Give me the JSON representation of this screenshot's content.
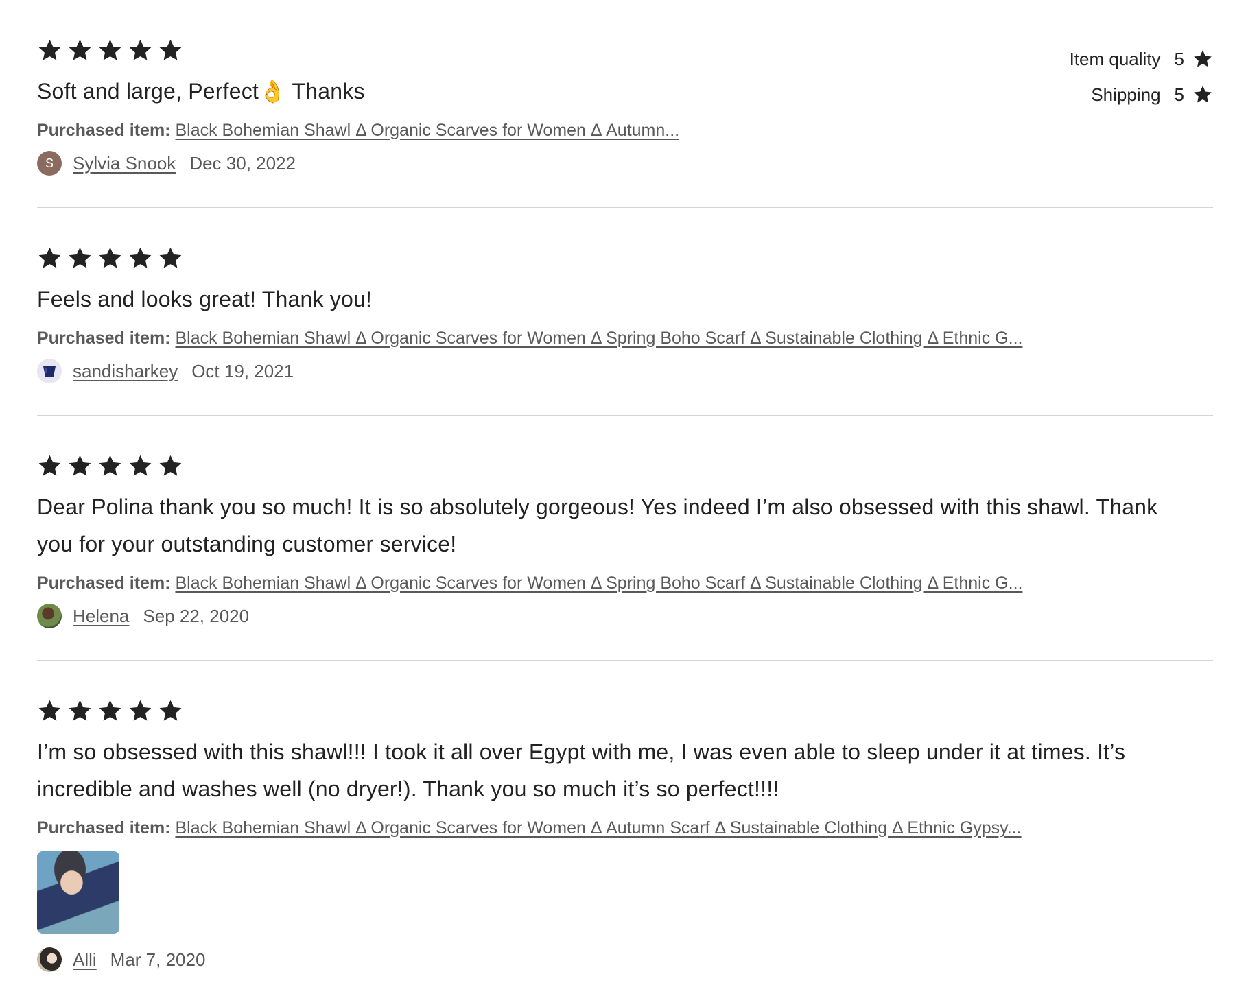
{
  "reviews": [
    {
      "rating": 5,
      "text": "Soft and large, Perfect👌 Thanks",
      "purchased_label": "Purchased item:",
      "purchased_item": "Black Bohemian Shawl Δ Organic Scarves for Women Δ Autumn...",
      "reviewer": "Sylvia Snook",
      "avatar_letter": "S",
      "date": "Dec 30, 2022",
      "sub_ratings": [
        {
          "label": "Item quality",
          "value": "5"
        },
        {
          "label": "Shipping",
          "value": "5"
        }
      ]
    },
    {
      "rating": 5,
      "text": "Feels and looks great! Thank you!",
      "purchased_label": "Purchased item:",
      "purchased_item": "Black Bohemian Shawl Δ Organic Scarves for Women Δ Spring Boho Scarf Δ Sustainable Clothing Δ Ethnic G...",
      "reviewer": "sandisharkey",
      "date": "Oct 19, 2021"
    },
    {
      "rating": 5,
      "text": "Dear Polina thank you so much! It is so absolutely gorgeous! Yes indeed I’m also obsessed with this shawl. Thank you for your outstanding customer service!",
      "purchased_label": "Purchased item:",
      "purchased_item": "Black Bohemian Shawl Δ Organic Scarves for Women Δ Spring Boho Scarf Δ Sustainable Clothing Δ Ethnic G...",
      "reviewer": "Helena",
      "date": "Sep 22, 2020"
    },
    {
      "rating": 5,
      "text": "I’m so obsessed with this shawl!!! I took it all over Egypt with me, I was even able to sleep under it at times. It’s incredible and washes well (no dryer!). Thank you so much it’s so perfect!!!!",
      "purchased_label": "Purchased item:",
      "purchased_item": "Black Bohemian Shawl Δ Organic Scarves for Women Δ Autumn Scarf Δ Sustainable Clothing Δ Ethnic Gypsy...",
      "reviewer": "Alli",
      "date": "Mar 7, 2020"
    }
  ],
  "icons": {
    "star": "star-icon",
    "avatar_cup": "cup-icon"
  },
  "colors": {
    "text": "#222222",
    "muted": "#595959",
    "divider": "#d4d4d4",
    "avatar_letter_bg": "#8a6b5e"
  }
}
